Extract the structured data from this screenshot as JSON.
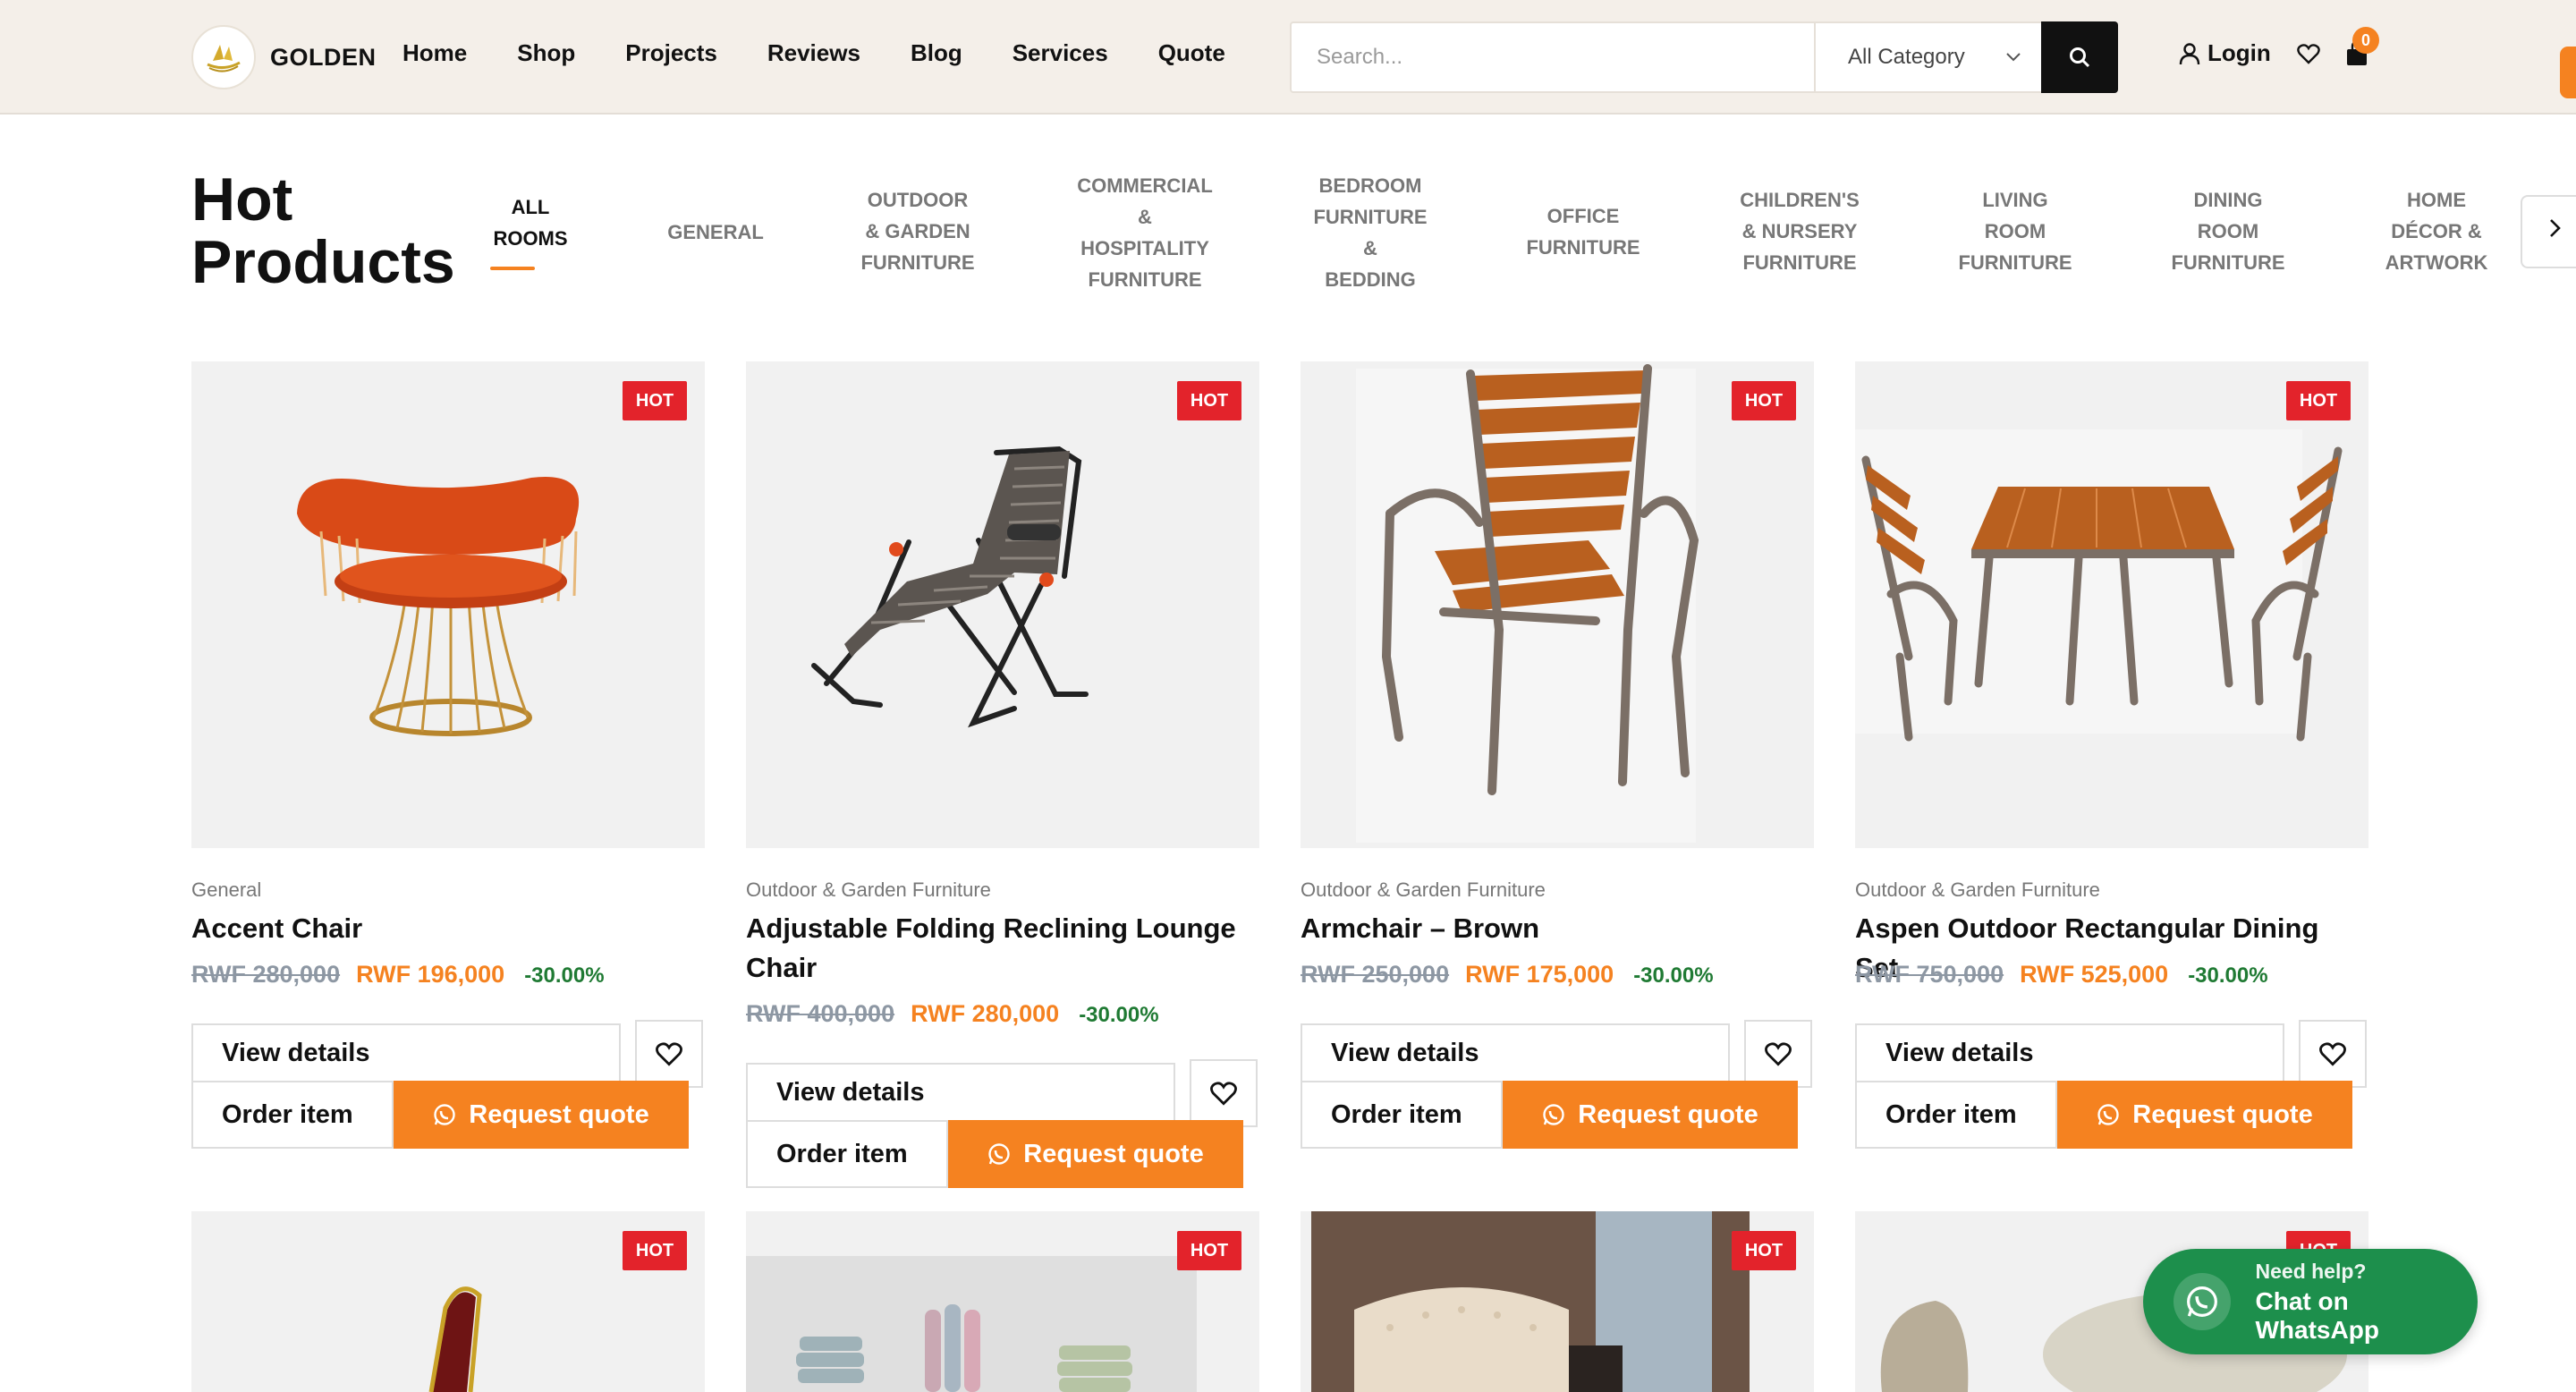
{
  "header": {
    "logo_text": "GOLDEN",
    "nav": [
      "Home",
      "Shop",
      "Projects",
      "Reviews",
      "Blog",
      "Services",
      "Quote"
    ],
    "search_placeholder": "Search...",
    "category_selected": "All Category",
    "login_label": "Login",
    "cart_count": "0"
  },
  "section": {
    "title_line1": "Hot",
    "title_line2": "Products",
    "tabs": [
      [
        "ALL",
        "ROOMS"
      ],
      [
        "GENERAL"
      ],
      [
        "OUTDOOR",
        "& GARDEN",
        "FURNITURE"
      ],
      [
        "COMMERCIAL",
        "&",
        "HOSPITALITY",
        "FURNITURE"
      ],
      [
        "BEDROOM",
        "FURNITURE",
        "&",
        "BEDDING"
      ],
      [
        "OFFICE",
        "FURNITURE"
      ],
      [
        "CHILDREN'S",
        "& NURSERY",
        "FURNITURE"
      ],
      [
        "LIVING",
        "ROOM",
        "FURNITURE"
      ],
      [
        "DINING",
        "ROOM",
        "FURNITURE"
      ],
      [
        "HOME",
        "DÉCOR &",
        "ARTWORK"
      ]
    ]
  },
  "badge_label": "HOT",
  "buttons": {
    "view": "View details",
    "order": "Order item",
    "quote": "Request quote"
  },
  "products": [
    {
      "category": "General",
      "name": "Accent Chair",
      "old_price": "RWF 280,000",
      "new_price": "RWF 196,000",
      "discount": "-30.00%"
    },
    {
      "category": "Outdoor & Garden Furniture",
      "name": "Adjustable Folding Reclining Lounge Chair",
      "old_price": "RWF 400,000",
      "new_price": "RWF 280,000",
      "discount": "-30.00%"
    },
    {
      "category": "Outdoor & Garden Furniture",
      "name": "Armchair – Brown",
      "old_price": "RWF 250,000",
      "new_price": "RWF 175,000",
      "discount": "-30.00%"
    },
    {
      "category": "Outdoor & Garden Furniture",
      "name": "Aspen Outdoor Rectangular Dining Set",
      "old_price": "RWF 750,000",
      "new_price": "RWF 525,000",
      "discount": "-30.00%"
    }
  ],
  "whatsapp": {
    "line1": "Need help?",
    "line2": "Chat on WhatsApp"
  },
  "colors": {
    "accent": "#f58220",
    "hot_badge": "#e3232b",
    "discount": "#1f7a33",
    "whatsapp": "#1d8f4c",
    "header_bg": "#f4efe9"
  }
}
